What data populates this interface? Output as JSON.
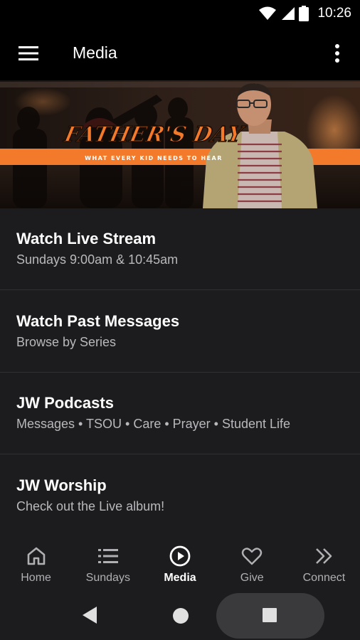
{
  "status_bar": {
    "time": "10:26",
    "icons": [
      "wifi-icon",
      "signal-icon",
      "battery-icon"
    ]
  },
  "app_bar": {
    "title": "Media",
    "left_icon": "hamburger-menu-icon",
    "right_icon": "more-vert-icon"
  },
  "banner": {
    "headline": "FATHER'S DAY",
    "tagline": "WHAT EVERY KID NEEDS TO HEAR",
    "accent_color": "#f47a2b"
  },
  "media_items": [
    {
      "title": "Watch Live Stream",
      "subtitle": "Sundays 9:00am & 10:45am"
    },
    {
      "title": "Watch Past Messages",
      "subtitle": "Browse by Series"
    },
    {
      "title": "JW Podcasts",
      "subtitle": "Messages • TSOU • Care • Prayer • Student Life"
    },
    {
      "title": "JW Worship",
      "subtitle": "Check out the Live album!"
    }
  ],
  "bottom_nav": [
    {
      "label": "Home",
      "icon": "home-icon",
      "active": false
    },
    {
      "label": "Sundays",
      "icon": "list-icon",
      "active": false
    },
    {
      "label": "Media",
      "icon": "play-circle-icon",
      "active": true
    },
    {
      "label": "Give",
      "icon": "heart-icon",
      "active": false
    },
    {
      "label": "Connect",
      "icon": "double-chevron-right-icon",
      "active": false
    }
  ],
  "system_nav": {
    "icons": [
      "back-icon",
      "home-circle-icon",
      "recents-icon"
    ]
  },
  "colors": {
    "background": "#1c1c1e",
    "app_bar": "#000000",
    "divider": "#303033",
    "subtitle": "#b9b9bd"
  }
}
